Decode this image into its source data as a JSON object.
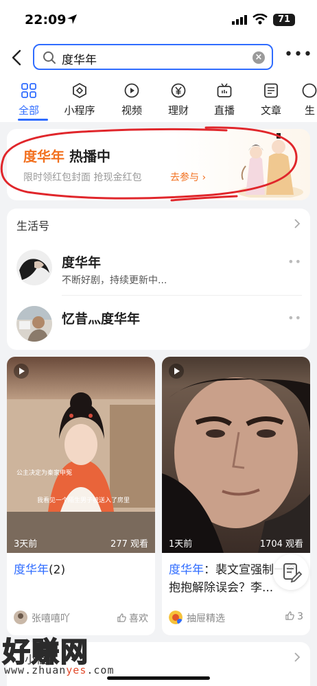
{
  "status_bar": {
    "time": "22:09",
    "battery": "71"
  },
  "search": {
    "query": "度华年",
    "clear_icon": "close-circle-icon",
    "more_label": "•••"
  },
  "tabs": [
    {
      "label": "全部",
      "icon": "grid-icon",
      "active": true
    },
    {
      "label": "小程序",
      "icon": "mini-program-icon"
    },
    {
      "label": "视频",
      "icon": "play-icon"
    },
    {
      "label": "理财",
      "icon": "yen-icon"
    },
    {
      "label": "直播",
      "icon": "tv-icon"
    },
    {
      "label": "文章",
      "icon": "document-icon"
    },
    {
      "label": "生",
      "icon": "life-icon"
    }
  ],
  "promo": {
    "title_highlight": "度华年",
    "title_rest": " 热播中",
    "subtitle": "限时领红包封面 抢现金红包",
    "cta": "去参与 ›"
  },
  "life": {
    "header": "生活号",
    "accounts": [
      {
        "name": "度华年",
        "desc": "不断好剧，持续更新中...",
        "dots": "••"
      },
      {
        "name": "忆昔灬度华年",
        "desc": "",
        "dots": "••"
      }
    ]
  },
  "videos": [
    {
      "age": "3天前",
      "views": "277 观看",
      "title_highlight": "度华年",
      "title_rest": "(2)",
      "author": "张嘻嘻吖",
      "like": "喜欢",
      "caption_top": "公主决定为秦家申冤",
      "caption_bottom": "我看见一个陌生男子被送入了房里"
    },
    {
      "age": "1天前",
      "views": "1704 观看",
      "title_highlight": "度华年",
      "title_rest": "：裴文宣强制一个抱抱解除误会？李...",
      "author": "抽屉精选",
      "like": "3"
    }
  ],
  "mini_program": {
    "header": "小程序"
  },
  "watermark": {
    "big": "好赚网",
    "small_pre": "www.zhuan",
    "small_hl": "yes",
    "small_post": ".com"
  },
  "colors": {
    "accent": "#2f6cff",
    "orange": "#f2701f",
    "scribble": "#e0262b"
  }
}
